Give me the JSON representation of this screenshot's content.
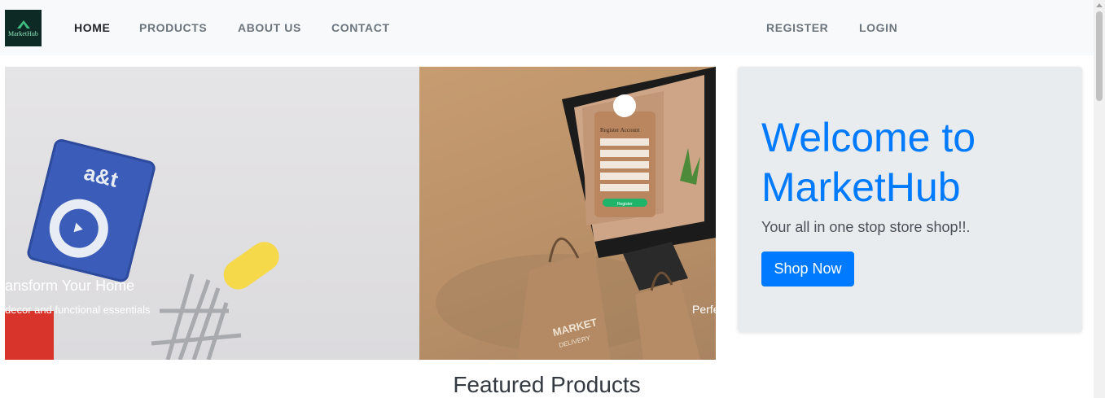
{
  "brand": {
    "logo_text": "MarketHub"
  },
  "nav": {
    "left": [
      {
        "label": "HOME",
        "active": true
      },
      {
        "label": "PRODUCTS",
        "active": false
      },
      {
        "label": "ABOUT US",
        "active": false
      },
      {
        "label": "CONTACT",
        "active": false
      }
    ],
    "right": [
      {
        "label": "REGISTER"
      },
      {
        "label": "LOGIN"
      }
    ]
  },
  "carousel": {
    "slide1_title": "ansform Your Home",
    "slide1_text": "decor and functional essentials",
    "slide2_peek": "Perfe",
    "product_text": {
      "player_brand": "a&t",
      "form_title": "Register Account",
      "form_button": "Register",
      "bag_title": "MARKET",
      "bag_subtitle": "DELIVERY"
    }
  },
  "jumbotron": {
    "title": "Welcome to MarketHub",
    "text": "Your all in one stop store shop!!.",
    "button": "Shop Now"
  },
  "featured_title": "Featured Products",
  "colors": {
    "primary": "#007bff",
    "navbar_bg": "#f8f9fa",
    "jumbotron_bg": "#e9ecef"
  }
}
